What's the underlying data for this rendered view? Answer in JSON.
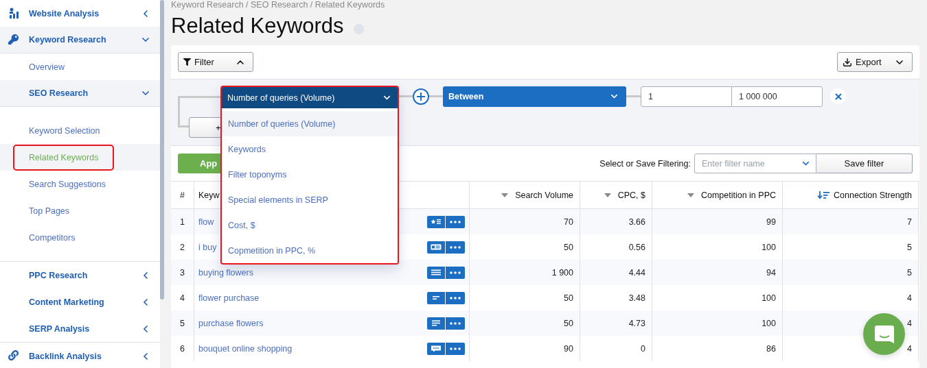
{
  "sidebar": {
    "items": [
      {
        "label": "Website Analysis",
        "expanded": false
      },
      {
        "label": "Keyword Research",
        "expanded": true,
        "children": [
          {
            "label": "Overview",
            "selected": false
          },
          {
            "label": "SEO Research",
            "expanded": true,
            "children": [
              {
                "label": "Keyword Selection",
                "selected": false
              },
              {
                "label": "Related Keywords",
                "selected": true
              },
              {
                "label": "Search Suggestions",
                "selected": false
              },
              {
                "label": "Top Pages",
                "selected": false
              },
              {
                "label": "Competitors",
                "selected": false
              }
            ]
          },
          {
            "label": "PPC Research",
            "expanded": false
          },
          {
            "label": "Content Marketing",
            "expanded": false
          },
          {
            "label": "SERP Analysis",
            "expanded": false
          }
        ]
      },
      {
        "label": "Backlink Analysis",
        "expanded": false
      }
    ]
  },
  "breadcrumb": "Keyword Research / SEO Research / Related Keywords",
  "title": "Related Keywords",
  "toolbar": {
    "filter_button": {
      "label": "Filter",
      "expanded": true
    },
    "export_button": {
      "label": "Export"
    }
  },
  "filter": {
    "field": {
      "value": "Number of queries (Volume)",
      "open": true,
      "options": [
        {
          "label": "Number of queries (Volume)",
          "selected": true
        },
        {
          "label": "Keywords",
          "selected": false
        },
        {
          "label": "Filter toponyms",
          "selected": false
        },
        {
          "label": "Special elements in SERP",
          "selected": false
        },
        {
          "label": "Cost, $",
          "selected": false
        },
        {
          "label": "Copmetition in PPC, %",
          "selected": false
        }
      ]
    },
    "operator": "Between",
    "from": "1",
    "to": "1 000 000",
    "add_button": "+",
    "apply_button": "App"
  },
  "save": {
    "label": "Select or Save Filtering:",
    "placeholder": "Enter filter name",
    "button": "Save filter"
  },
  "table": {
    "columns": [
      {
        "label": "#",
        "kind": "plain"
      },
      {
        "label": "Keyw",
        "kind": "plain"
      },
      {
        "label": "Search Volume",
        "kind": "sortable"
      },
      {
        "label": "CPC, $",
        "kind": "sortable"
      },
      {
        "label": "Competition in PPC",
        "kind": "sortable"
      },
      {
        "label": "Connection Strength",
        "kind": "sorted"
      }
    ],
    "rows": [
      {
        "n": "1",
        "keyword": "flow",
        "kind": "featured",
        "volume": "70",
        "cpc": "3.66",
        "competition": "99",
        "strength": "7"
      },
      {
        "n": "2",
        "keyword": "i buy",
        "kind": "card",
        "volume": "50",
        "cpc": "0.56",
        "competition": "100",
        "strength": "5"
      },
      {
        "n": "3",
        "keyword": "buying flowers",
        "kind": "list",
        "volume": "1 900",
        "cpc": "4.44",
        "competition": "94",
        "strength": "5"
      },
      {
        "n": "4",
        "keyword": "flower purchase",
        "kind": "short",
        "volume": "50",
        "cpc": "3.48",
        "competition": "100",
        "strength": "4"
      },
      {
        "n": "5",
        "keyword": "purchase flowers",
        "kind": "lines",
        "volume": "50",
        "cpc": "4.73",
        "competition": "100",
        "strength": "4"
      },
      {
        "n": "6",
        "keyword": "bouquet online shopping",
        "kind": "chat",
        "volume": "90",
        "cpc": "0",
        "competition": "86",
        "strength": "4"
      }
    ]
  }
}
